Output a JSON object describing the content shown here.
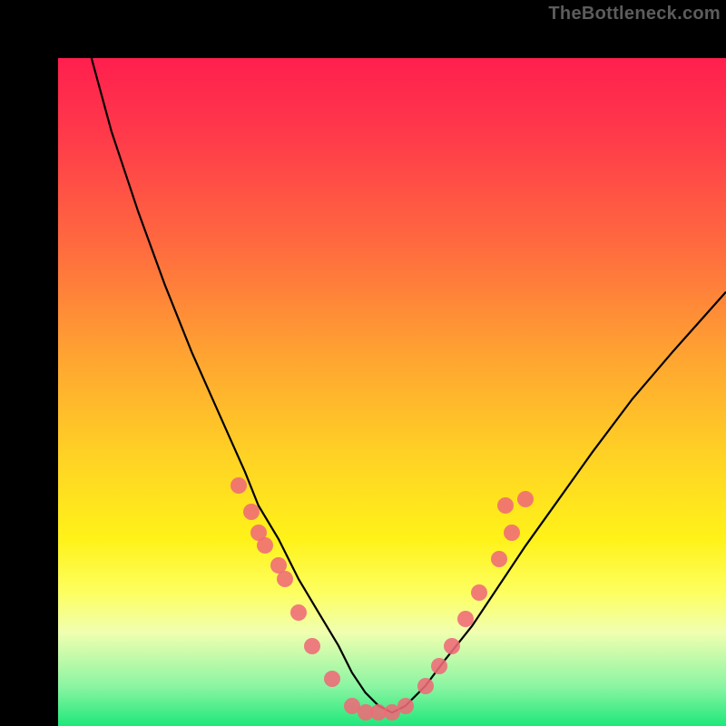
{
  "watermark": "TheBottleneck.com",
  "chart_data": {
    "type": "line",
    "title": "",
    "xlabel": "",
    "ylabel": "",
    "xlim": [
      0,
      100
    ],
    "ylim": [
      0,
      100
    ],
    "background_gradient": {
      "top": "#ff1f4e",
      "bottom": "#1ee87a"
    },
    "series": [
      {
        "name": "curve",
        "x": [
          5,
          8,
          12,
          16,
          20,
          24,
          28,
          30,
          33,
          36,
          39,
          42,
          44,
          46,
          48,
          50,
          52,
          55,
          58,
          62,
          66,
          70,
          75,
          80,
          86,
          92,
          100
        ],
        "y": [
          100,
          89,
          77,
          66,
          56,
          47,
          38,
          33,
          28,
          22,
          17,
          12,
          8,
          5,
          3,
          2,
          3,
          6,
          10,
          15,
          21,
          27,
          34,
          41,
          49,
          56,
          65
        ]
      }
    ],
    "markers": {
      "name": "cluster-dots",
      "color": "#ef6a77",
      "points": [
        {
          "x": 27,
          "y": 36
        },
        {
          "x": 29,
          "y": 32
        },
        {
          "x": 30,
          "y": 29
        },
        {
          "x": 31,
          "y": 27
        },
        {
          "x": 33,
          "y": 24
        },
        {
          "x": 34,
          "y": 22
        },
        {
          "x": 36,
          "y": 17
        },
        {
          "x": 38,
          "y": 12
        },
        {
          "x": 41,
          "y": 7
        },
        {
          "x": 44,
          "y": 3
        },
        {
          "x": 46,
          "y": 2
        },
        {
          "x": 48,
          "y": 2
        },
        {
          "x": 50,
          "y": 2
        },
        {
          "x": 52,
          "y": 3
        },
        {
          "x": 55,
          "y": 6
        },
        {
          "x": 57,
          "y": 9
        },
        {
          "x": 59,
          "y": 12
        },
        {
          "x": 61,
          "y": 16
        },
        {
          "x": 63,
          "y": 20
        },
        {
          "x": 66,
          "y": 25
        },
        {
          "x": 68,
          "y": 29
        },
        {
          "x": 67,
          "y": 33
        },
        {
          "x": 70,
          "y": 34
        }
      ]
    }
  }
}
